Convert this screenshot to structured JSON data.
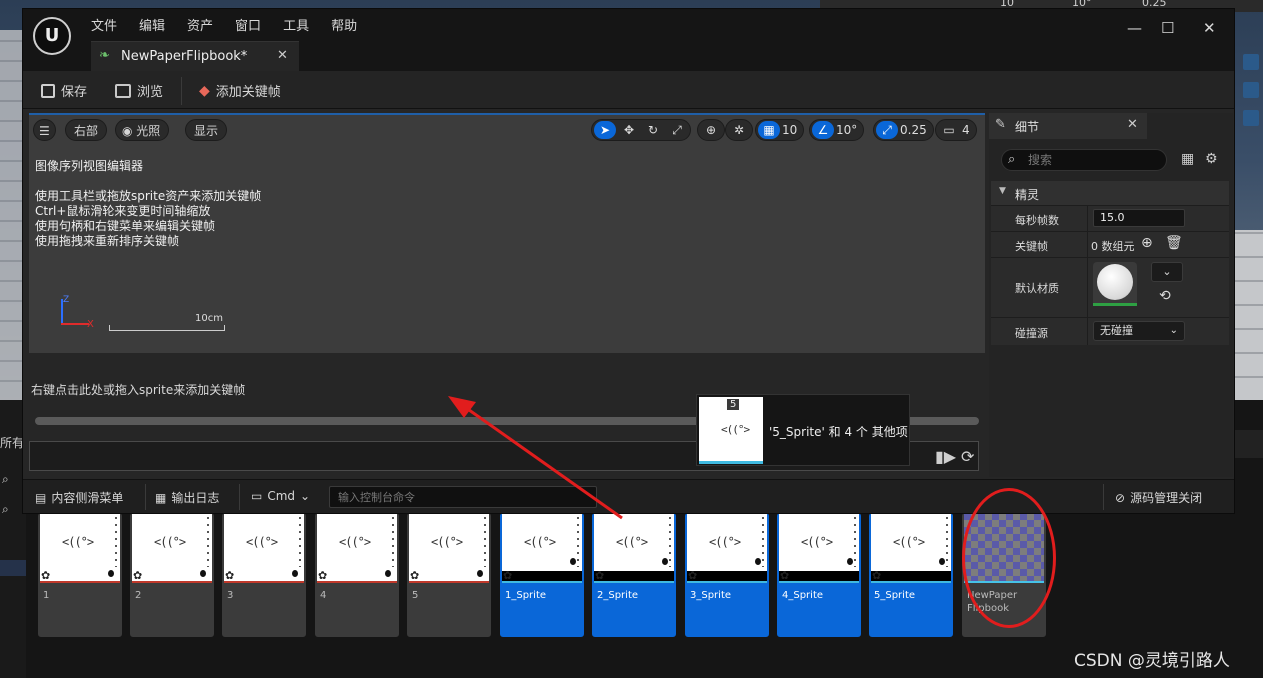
{
  "background": {
    "content_browser_left_tab": "所有",
    "assets": [
      {
        "label": "1",
        "kind": "texture"
      },
      {
        "label": "2",
        "kind": "texture"
      },
      {
        "label": "3",
        "kind": "texture"
      },
      {
        "label": "4",
        "kind": "texture"
      },
      {
        "label": "5",
        "kind": "texture"
      },
      {
        "label": "1_Sprite",
        "kind": "sprite"
      },
      {
        "label": "2_Sprite",
        "kind": "sprite"
      },
      {
        "label": "3_Sprite",
        "kind": "sprite"
      },
      {
        "label": "4_Sprite",
        "kind": "sprite"
      },
      {
        "label": "5_Sprite",
        "kind": "sprite"
      },
      {
        "label": "NewPaper\nFlipbook",
        "kind": "flipbook"
      }
    ],
    "top_strip": [
      "10",
      "10°",
      "0.25"
    ]
  },
  "window": {
    "menu": [
      "文件",
      "编辑",
      "资产",
      "窗口",
      "工具",
      "帮助"
    ],
    "tab_title": "NewPaperFlipbook*",
    "controls": {
      "minimize": "—",
      "maximize": "☐",
      "close": "✕"
    },
    "toolbar": {
      "save_label": "保存",
      "browse_label": "浏览",
      "add_keyframe_label": "添加关键帧"
    },
    "viewport": {
      "view_mode": "右部",
      "lighting": "光照",
      "show": "显示",
      "grid_value": "10",
      "rotation_value": "10°",
      "scale_value": "0.25",
      "camera_speed": "4",
      "title": "图像序列视图编辑器",
      "help_lines": [
        "使用工具栏或拖放sprite资产来添加关键帧",
        "Ctrl+鼠标滑轮来变更时间轴缩放",
        "使用句柄和右键菜单来编辑关键帧",
        "使用拖拽来重新排序关键帧"
      ],
      "axis_z": "Z",
      "axis_x": "X",
      "scale_label": "10cm"
    },
    "timeline": {
      "hint": "右键点击此处或拖入sprite来添加关键帧"
    },
    "drag_tooltip": {
      "badge": "5",
      "text": "'5_Sprite' 和 4 个 其他项"
    },
    "details": {
      "tab_label": "细节",
      "search_placeholder": "搜索",
      "category": "精灵",
      "fps_label": "每秒帧数",
      "fps_value": "15.0",
      "keyframes_label": "关键帧",
      "keyframes_value": "0 数组元",
      "material_label": "默认材质",
      "collision_label": "碰撞源",
      "collision_value": "无碰撞"
    },
    "statusbar": {
      "content_drawer": "内容侧滑菜单",
      "output_log": "输出日志",
      "cmd": "Cmd",
      "cmd_placeholder": "输入控制台命令",
      "source_control": "源码管理关闭"
    }
  },
  "watermark": "CSDN @灵境引路人",
  "colors": {
    "accent": "#0a67d8",
    "annotation": "#e11d1d"
  }
}
